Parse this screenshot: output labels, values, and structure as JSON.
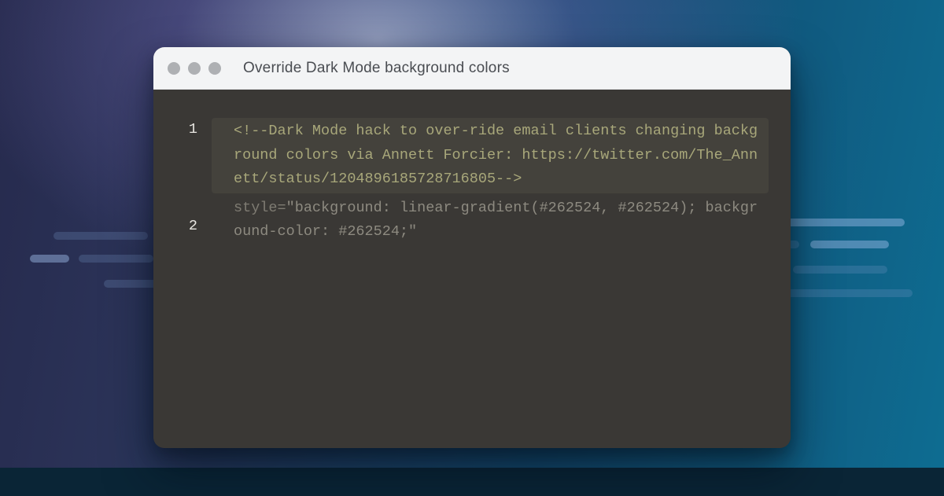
{
  "window": {
    "title": "Override Dark Mode background colors"
  },
  "code": {
    "line_numbers": [
      "1",
      "2"
    ],
    "line1": "<!--Dark Mode hack to over-ride email clients changing background colors via Annett Forcier: https://twitter.com/The_Annett/status/1204896185728716805-->",
    "line2_prefix": "style=",
    "line2_value": "\"background: linear-gradient(#262524, #262524); background-color: #262524;\""
  },
  "colors": {
    "editor_bg": "#3a3835",
    "highlight_bg": "#44423c",
    "comment": "#a8a77a",
    "dim": "#8d8a80"
  }
}
